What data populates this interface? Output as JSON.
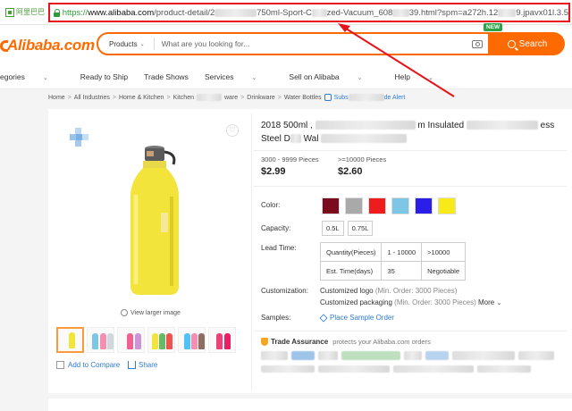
{
  "browser": {
    "logo_text": "阿里巴巴",
    "url_scheme": "https://",
    "url_host": "www.alibaba.com",
    "url_path_start": "/product-detail/2",
    "url_path_mid": "750ml-Sport-C",
    "url_path_mid2": "zed-Vacuum_608",
    "url_path_end": "39.html?spm=a272h.12",
    "url_tail": "9.jpavx01l.3.5"
  },
  "header": {
    "brand": "Alibaba.com",
    "search_category": "Products",
    "search_placeholder": "What are you looking for...",
    "search_button": "Search",
    "new_badge": "NEW"
  },
  "nav": {
    "items": [
      "egories",
      "Ready to Ship",
      "Trade Shows",
      "Services",
      "Sell on Alibaba",
      "Help"
    ]
  },
  "breadcrumb": {
    "items": [
      "Home",
      "All Industries",
      "Home & Kitchen",
      "Kitchen",
      "ware",
      "Drinkware",
      "Water Bottles"
    ],
    "subscribe_start": "Subs",
    "subscribe_end": "de Alert"
  },
  "product": {
    "title_line1_start": "2018 500ml ,",
    "title_line1_mid": "m Insulated",
    "title_line1_end": "ess",
    "title_line2_start": "Steel D",
    "title_line2_mid": "Wal",
    "prices": [
      {
        "range": "3000 - 9999 Pieces",
        "price": "$2.99"
      },
      {
        "range": ">=10000 Pieces",
        "price": "$2.60"
      }
    ],
    "color_label": "Color:",
    "colors": [
      "#7b0a1e",
      "#a9a9a9",
      "#ee1c1c",
      "#7ec6e6",
      "#2a1ee8",
      "#f7ea18"
    ],
    "capacity_label": "Capacity:",
    "capacities": [
      "0.5L",
      "0.75L"
    ],
    "lead_time_label": "Lead Time:",
    "lead_table": [
      [
        "Quantity(Pieces)",
        "1 - 10000",
        ">10000"
      ],
      [
        "Est. Time(days)",
        "35",
        "Negotiable"
      ]
    ],
    "customization_label": "Customization:",
    "custom_logo": "Customized logo",
    "custom_logo_moq": "(Min. Order: 3000 Pieces)",
    "custom_packaging": "Customized packaging",
    "custom_packaging_moq": "(Min. Order: 3000 Pieces)",
    "more": "More",
    "samples_label": "Samples:",
    "place_sample": "Place Sample Order",
    "trade_assurance": "Trade Assurance",
    "trade_assurance_sub": "protects your Alibaba.com orders",
    "view_larger": "View larger image",
    "add_compare": "Add to Compare",
    "share": "Share"
  }
}
